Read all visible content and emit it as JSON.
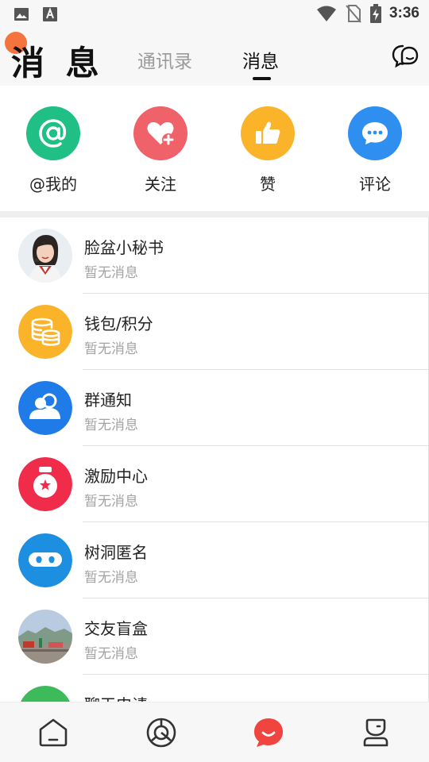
{
  "status_bar": {
    "time": "3:36",
    "icons": [
      "image-icon",
      "text-a-icon",
      "wifi-icon",
      "no-sim-icon",
      "battery-charging-icon"
    ]
  },
  "header": {
    "title": "消 息",
    "tabs": [
      {
        "label": "通讯录",
        "active": false
      },
      {
        "label": "消息",
        "active": true
      }
    ],
    "right_icon": "chat-bubbles-icon"
  },
  "quick_actions": [
    {
      "label": "@我的",
      "icon": "at-icon",
      "color": "#1fbf86"
    },
    {
      "label": "关注",
      "icon": "heart-plus-icon",
      "color": "#f0626a"
    },
    {
      "label": "赞",
      "icon": "thumbs-up-icon",
      "color": "#fbb32a"
    },
    {
      "label": "评论",
      "icon": "comment-icon",
      "color": "#2e8ff0"
    }
  ],
  "messages": [
    {
      "name": "脸盆小秘书",
      "preview": "暂无消息",
      "avatar": "assistant-photo"
    },
    {
      "name": "钱包/积分",
      "preview": "暂无消息",
      "avatar": "coins-icon"
    },
    {
      "name": "群通知",
      "preview": "暂无消息",
      "avatar": "group-icon"
    },
    {
      "name": "激励中心",
      "preview": "暂无消息",
      "avatar": "medal-icon"
    },
    {
      "name": "树洞匿名",
      "preview": "暂无消息",
      "avatar": "ninja-icon"
    },
    {
      "name": "交友盲盒",
      "preview": "暂无消息",
      "avatar": "landscape-photo"
    },
    {
      "name": "聊天申请",
      "preview": "",
      "avatar": "chat-request-icon"
    }
  ],
  "bottom_nav": [
    {
      "name": "home",
      "icon": "home-icon",
      "active": false
    },
    {
      "name": "discover",
      "icon": "discover-icon",
      "active": false
    },
    {
      "name": "messages",
      "icon": "message-icon",
      "active": true,
      "color": "#f0453e"
    },
    {
      "name": "profile",
      "icon": "profile-icon",
      "active": false
    }
  ]
}
